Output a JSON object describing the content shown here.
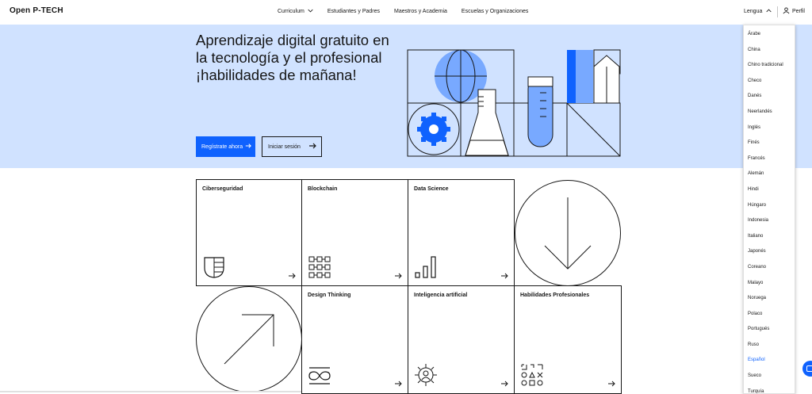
{
  "header": {
    "logo": "Open P‑TECH",
    "nav": [
      {
        "label": "Curriculum",
        "has_chevron": true
      },
      {
        "label": "Estudiantes y Padres"
      },
      {
        "label": "Maestros y Academia"
      },
      {
        "label": "Escuelas y Organizaciones"
      }
    ],
    "language_label": "Lengua",
    "profile_label": "Perfil"
  },
  "hero": {
    "title": "Aprendizaje digital gratuito en la tecnología y el profesional ¡habilidades de mañana!",
    "primary_button": "Regístrate ahora",
    "secondary_button": "Iniciar sesión",
    "colors": {
      "background": "#d0e2ff",
      "accent": "#0f62fe",
      "accent_light": "#78a9ff"
    }
  },
  "cards": [
    {
      "title": "Ciberseguridad",
      "icon": "shield-icon"
    },
    {
      "title": "Blockchain",
      "icon": "blockchain-grid-icon"
    },
    {
      "title": "Data Science",
      "icon": "bar-chart-icon"
    },
    {
      "title": "Design Thinking",
      "icon": "infinity-icon"
    },
    {
      "title": "Inteligencia artificial",
      "icon": "ai-chip-icon"
    },
    {
      "title": "Habilidades Profesionales",
      "icon": "shapes-icon"
    }
  ],
  "language_menu": {
    "items": [
      "Árabe",
      "China",
      "Chino tradicional",
      "Checo",
      "Danés",
      "Neerlandés",
      "Inglés",
      "Finés",
      "Francés",
      "Alemán",
      "Hindi",
      "Húngaro",
      "Indonesia",
      "Italiano",
      "Japonés",
      "Coreano",
      "Malayo",
      "Noruega",
      "Polaco",
      "Portugués",
      "Ruso",
      "Español",
      "Sueco",
      "Turquía"
    ],
    "selected": "Español"
  }
}
